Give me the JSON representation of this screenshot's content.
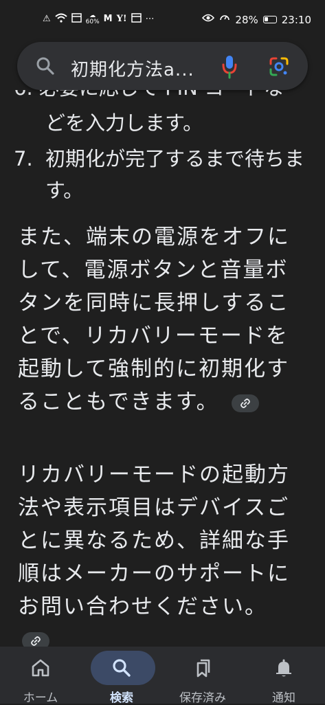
{
  "status_bar": {
    "left_icons": [
      "alert-icon",
      "wifi-icon",
      "calendar-icon",
      "weather-icon",
      "mail-icon",
      "yahoo-icon",
      "calendar-icon",
      "more-icon"
    ],
    "weather_percent": "60%",
    "battery_percent": "28%",
    "time": "23:10"
  },
  "search": {
    "query": "初期化方法a..."
  },
  "content": {
    "cutoff_text": "6.  必要に応じて PIN コードな",
    "list": [
      {
        "number": "",
        "text": "どを入力します。"
      },
      {
        "number": "7.",
        "text": "初期化が完了するまで待ちます。"
      }
    ],
    "paragraph1": "また、端末の電源をオフにして、電源ボタンと音量ボタンを同時に長押しすることで、リカバリーモードを起動して強制的に初期化することもできます。",
    "paragraph2": "リカバリーモードの起動方法や表示項目はデバイスごとに異なるため、詳細な手順はメーカーのサポートにお問い合わせください。"
  },
  "nav": [
    {
      "label": "ホーム",
      "icon": "home-icon",
      "active": false
    },
    {
      "label": "検索",
      "icon": "search-icon",
      "active": true
    },
    {
      "label": "保存済み",
      "icon": "bookmarks-icon",
      "active": false
    },
    {
      "label": "通知",
      "icon": "bell-icon",
      "active": false
    }
  ]
}
